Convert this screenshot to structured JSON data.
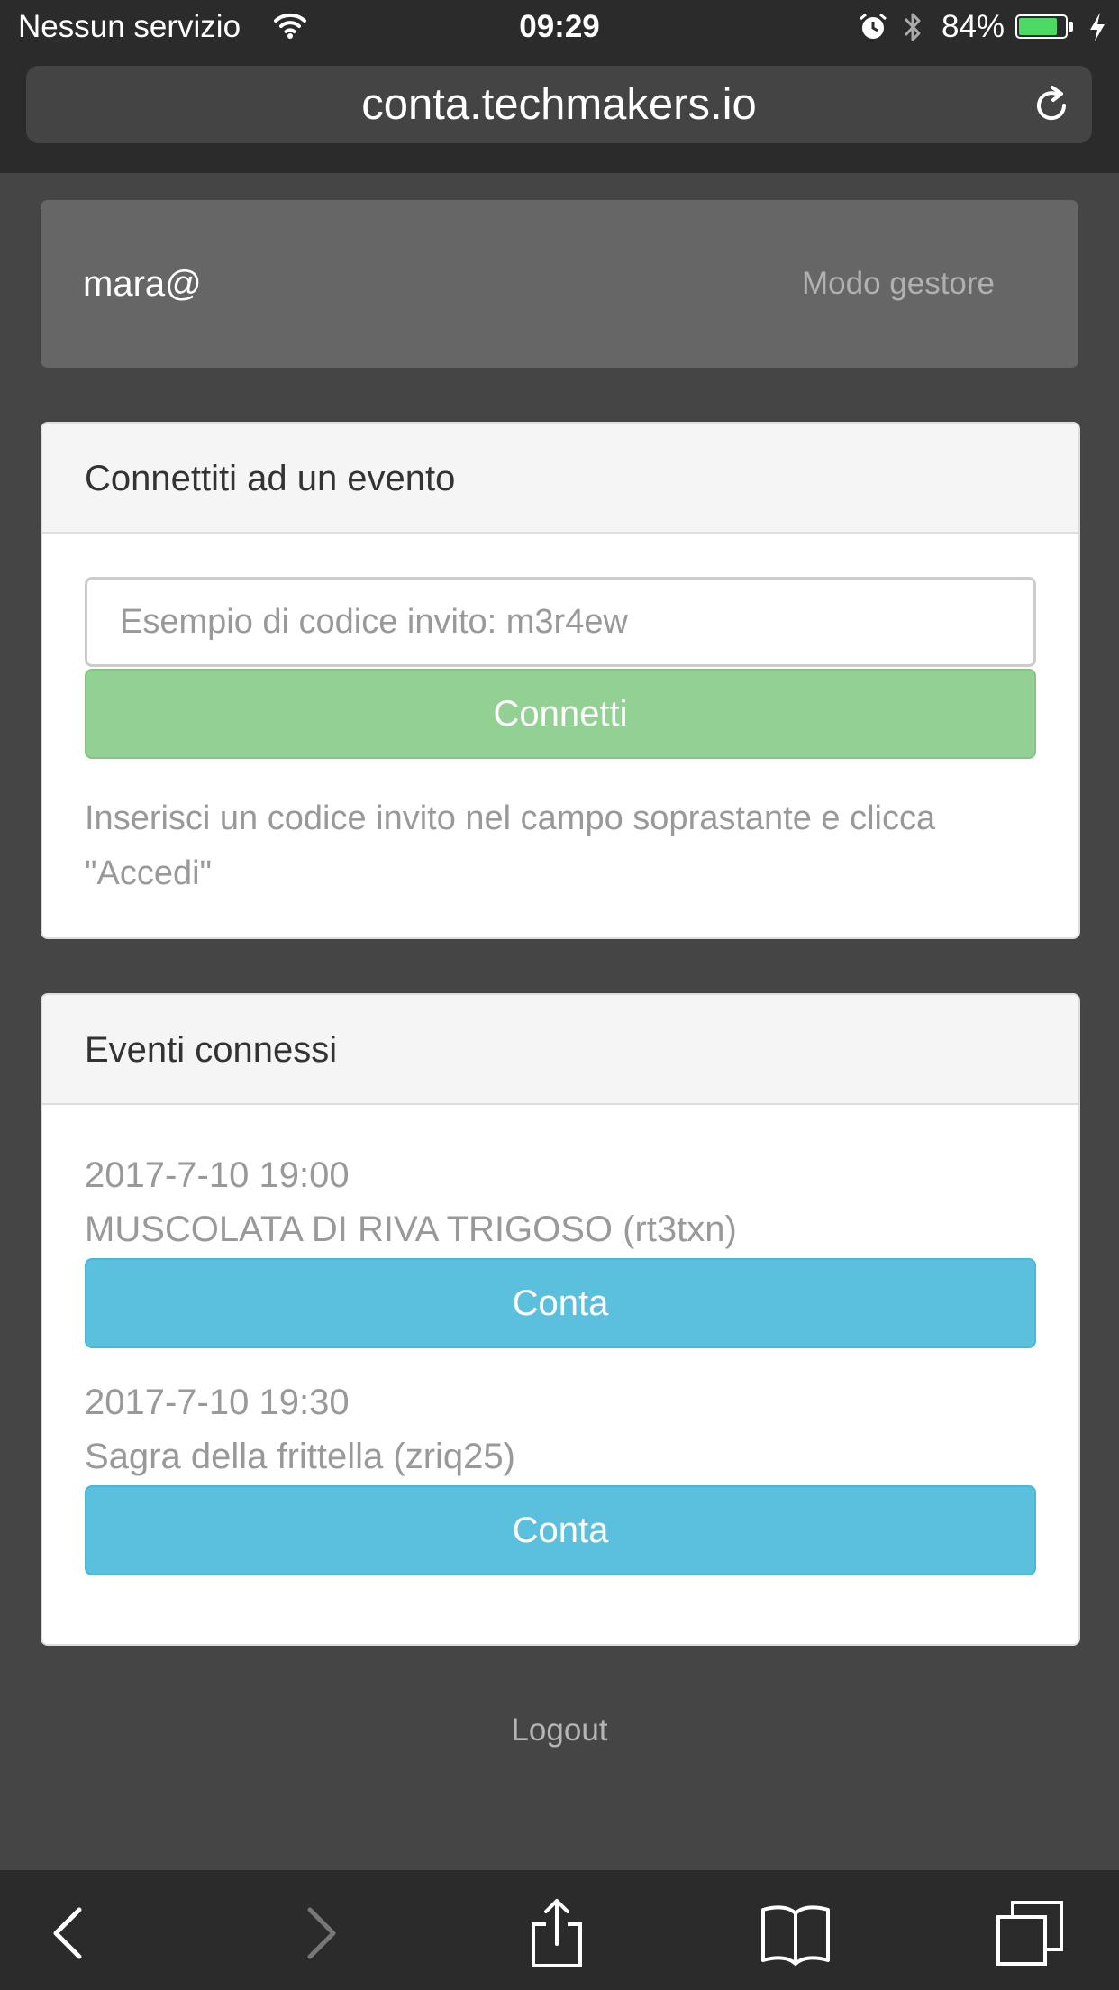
{
  "status_bar": {
    "carrier": "Nessun servizio",
    "time": "09:29",
    "battery_percent": "84%",
    "battery_level": 0.84,
    "battery_color": "#4cd964",
    "icons": [
      "wifi-icon",
      "alarm-icon",
      "bluetooth-icon",
      "battery-icon",
      "charging-bolt-icon"
    ]
  },
  "address_bar": {
    "url": "conta.techmakers.io",
    "reload_icon": "reload-icon"
  },
  "navbar": {
    "user": "mara@",
    "mode_link": "Modo gestore"
  },
  "connect_panel": {
    "title": "Connettiti ad un evento",
    "input_placeholder": "Esempio di codice invito: m3r4ew",
    "input_value": "",
    "button_label": "Connetti",
    "help_text": "Inserisci un codice invito nel campo soprastante e clicca \"Accedi\""
  },
  "events_panel": {
    "title": "Eventi connessi",
    "events": [
      {
        "datetime": "2017-7-10 19:00",
        "name": "MUSCOLATA DI RIVA TRIGOSO (rt3txn)",
        "button_label": "Conta"
      },
      {
        "datetime": "2017-7-10 19:30",
        "name": "Sagra della frittella (zriq25)",
        "button_label": "Conta"
      }
    ]
  },
  "logout_label": "Logout",
  "colors": {
    "connect_button": "#93d093",
    "conta_button": "#5bc0de",
    "page_background": "#454545"
  },
  "toolbar": {
    "icons": [
      "back-icon",
      "forward-icon",
      "share-icon",
      "bookmarks-icon",
      "tabs-icon"
    ]
  }
}
